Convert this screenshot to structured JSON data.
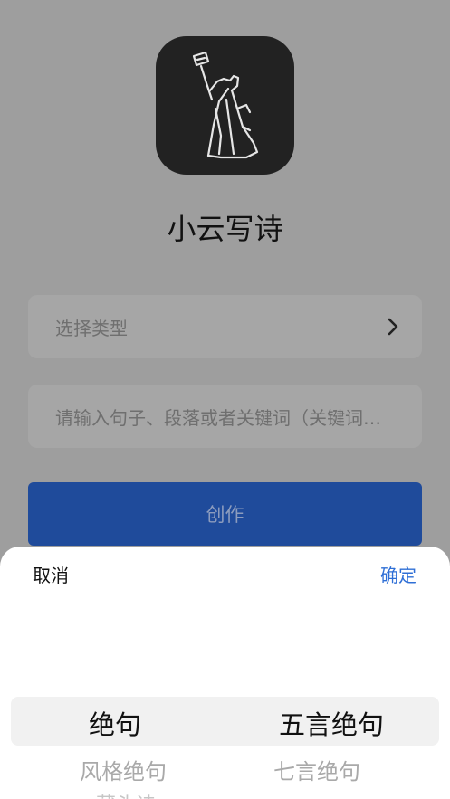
{
  "app": {
    "title": "小云写诗",
    "logo_icon": "poet-figure-icon"
  },
  "form": {
    "type_placeholder": "选择类型",
    "input_placeholder": "请输入句子、段落或者关键词（关键词…",
    "create_label": "创作"
  },
  "sheet": {
    "cancel_label": "取消",
    "confirm_label": "确定",
    "left_column": {
      "selected": "绝句",
      "next": "风格绝句",
      "far": "藏头诗"
    },
    "right_column": {
      "selected": "五言绝句",
      "next": "七言绝句"
    }
  },
  "colors": {
    "overlay": "#9e9e9e",
    "accent_blue": "#2f6fd6",
    "button_blue": "#1f4b9b",
    "icon_bg": "#222222"
  }
}
